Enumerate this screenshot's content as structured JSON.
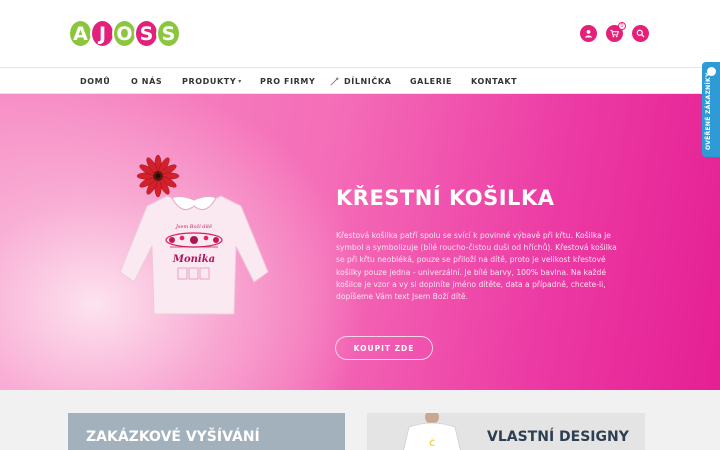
{
  "logo": {
    "letters": [
      "A",
      "J",
      "O",
      "S",
      "S"
    ],
    "colors": [
      "#8cc63f",
      "#e4217a",
      "#8cc63f",
      "#e4217a",
      "#8cc63f"
    ]
  },
  "header_icons": {
    "user": "user-icon",
    "cart": "cart-icon",
    "cart_count": "0",
    "search": "search-icon"
  },
  "nav": {
    "items": [
      "DOMŮ",
      "O NÁS",
      "PRODUKTY",
      "PRO FIRMY",
      "DÍLNIČKA",
      "GALERIE",
      "KONTAKT"
    ],
    "produkty_caret": "▾"
  },
  "hero": {
    "title": "KŘESTNÍ KOŠILKA",
    "text": "Křestová košilka patří spolu se svící k povinné výbavě při křtu. Košilka je symbol a symbolizuje (bílé roucho-čistou duši od hříchů). Křestová košilka se při křtu neobléká, pouze se přiloží na dítě, proto je velikost křestové košilky pouze jedna - univerzální. Je bílé barvy, 100% bavlna. Na každé košilce je vzor a vy si doplníte jméno dítěte, data a případně, chcete-li, dopíšeme Vám text Jsem Boží dítě.",
    "button": "KOUPIT ZDE",
    "shirt_name": "Monika",
    "accent": "#e4217a"
  },
  "side_tab": {
    "label": "OVĚŘENÉ ZÁKAZNÍKY"
  },
  "promos": {
    "left_title": "ZAKÁZKOVÉ VYŠÍVÁNÍ",
    "right_title": "VLASTNÍ DESIGNY"
  }
}
